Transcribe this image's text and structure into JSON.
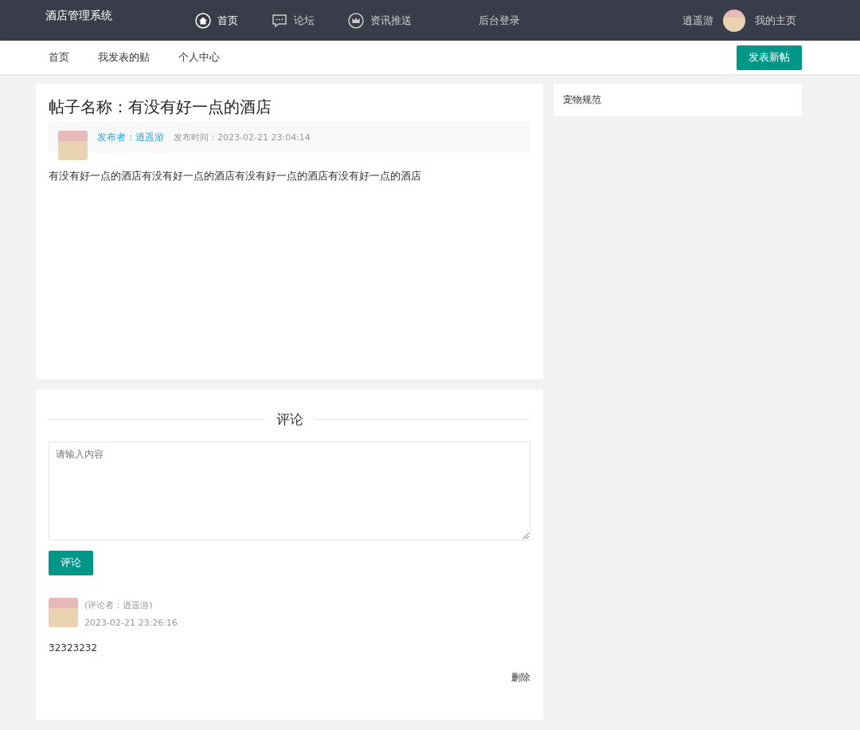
{
  "header": {
    "logo": "酒店管理系统",
    "nav": [
      {
        "label": "首页",
        "selected": true
      },
      {
        "label": "论坛",
        "selected": false
      },
      {
        "label": "资讯推送",
        "selected": false
      },
      {
        "label": "后台登录",
        "selected": false
      }
    ],
    "user": "逍遥游",
    "home_link": "我的主页"
  },
  "subnav": {
    "items": [
      "首页",
      "我发表的贴",
      "个人中心"
    ],
    "button": "发表新帖"
  },
  "post": {
    "title": "帖子名称：有没有好一点的酒店",
    "author": "发布者：逍遥游",
    "time": "发布时间：2023-02-21 23:04:14",
    "body": "有没有好一点的酒店有没有好一点的酒店有没有好一点的酒店有没有好一点的酒店"
  },
  "comments_section": {
    "heading": "评论",
    "placeholder": "请输入内容",
    "submit": "评论",
    "comments": [
      {
        "author": "(评论者：逍遥游)",
        "time": "2023-02-21 23:26:16",
        "content": "32323232",
        "delete": "删除"
      }
    ]
  },
  "sidebar": {
    "title": "宠物规范"
  }
}
